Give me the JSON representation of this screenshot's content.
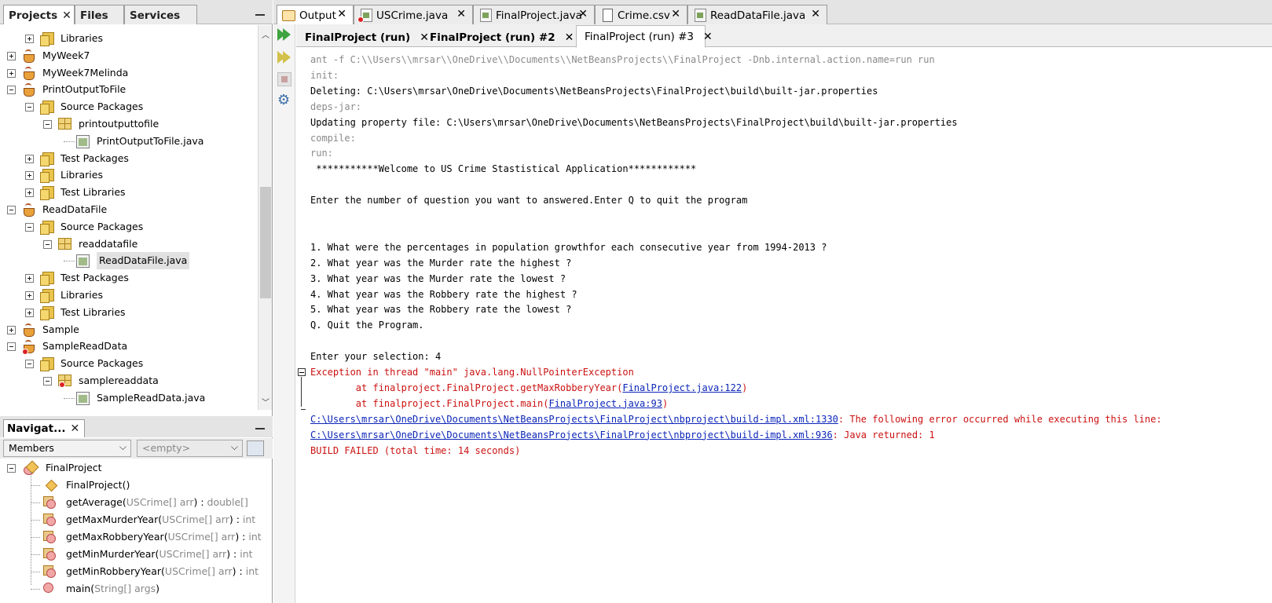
{
  "projects_panel": {
    "tabs": [
      "Projects",
      "Files",
      "Services"
    ],
    "tree": [
      {
        "label": "Libraries",
        "indent": 1,
        "toggle": "plus",
        "icon": "library-folder-icon"
      },
      {
        "label": "MyWeek7",
        "indent": 0,
        "toggle": "plus",
        "icon": "java-project-icon"
      },
      {
        "label": "MyWeek7Melinda",
        "indent": 0,
        "toggle": "plus",
        "icon": "java-project-icon"
      },
      {
        "label": "PrintOutputToFile",
        "indent": 0,
        "toggle": "minus",
        "icon": "java-project-icon"
      },
      {
        "label": "Source Packages",
        "indent": 1,
        "toggle": "minus",
        "icon": "source-folder-icon"
      },
      {
        "label": "printoutputtofile",
        "indent": 2,
        "toggle": "minus",
        "icon": "package-icon"
      },
      {
        "label": "PrintOutputToFile.java",
        "indent": 3,
        "toggle": "none",
        "icon": "java-file-icon"
      },
      {
        "label": "Test Packages",
        "indent": 1,
        "toggle": "plus",
        "icon": "test-folder-icon"
      },
      {
        "label": "Libraries",
        "indent": 1,
        "toggle": "plus",
        "icon": "library-folder-icon"
      },
      {
        "label": "Test Libraries",
        "indent": 1,
        "toggle": "plus",
        "icon": "library-folder-icon"
      },
      {
        "label": "ReadDataFile",
        "indent": 0,
        "toggle": "minus",
        "icon": "java-project-icon"
      },
      {
        "label": "Source Packages",
        "indent": 1,
        "toggle": "minus",
        "icon": "source-folder-icon"
      },
      {
        "label": "readdatafile",
        "indent": 2,
        "toggle": "minus",
        "icon": "package-icon"
      },
      {
        "label": "ReadDataFile.java",
        "indent": 3,
        "toggle": "none",
        "icon": "java-file-icon",
        "selected": true
      },
      {
        "label": "Test Packages",
        "indent": 1,
        "toggle": "plus",
        "icon": "test-folder-icon"
      },
      {
        "label": "Libraries",
        "indent": 1,
        "toggle": "plus",
        "icon": "library-folder-icon"
      },
      {
        "label": "Test Libraries",
        "indent": 1,
        "toggle": "plus",
        "icon": "library-folder-icon"
      },
      {
        "label": "Sample",
        "indent": 0,
        "toggle": "plus",
        "icon": "java-project-icon"
      },
      {
        "label": "SampleReadData",
        "indent": 0,
        "toggle": "minus",
        "icon": "java-project-error-icon"
      },
      {
        "label": "Source Packages",
        "indent": 1,
        "toggle": "minus",
        "icon": "source-folder-error-icon"
      },
      {
        "label": "samplereaddata",
        "indent": 2,
        "toggle": "minus",
        "icon": "package-error-icon"
      },
      {
        "label": "SampleReadData.java",
        "indent": 3,
        "toggle": "none",
        "icon": "java-file-icon"
      }
    ]
  },
  "navigator": {
    "title": "Navigat...",
    "filter": "Members",
    "context": "<empty>",
    "root": "FinalProject",
    "members": [
      {
        "name": "FinalProject()",
        "type": "",
        "icon": "constructor-icon"
      },
      {
        "name": "getAverage(",
        "params": "USCrime[] arr",
        "close": ") : ",
        "type": "double[]",
        "icon": "static-method-icon"
      },
      {
        "name": "getMaxMurderYear(",
        "params": "USCrime[] arr",
        "close": ") : ",
        "type": "int",
        "icon": "static-method-icon"
      },
      {
        "name": "getMaxRobberyYear(",
        "params": "USCrime[] arr",
        "close": ") : ",
        "type": "int",
        "icon": "static-method-icon"
      },
      {
        "name": "getMinMurderYear(",
        "params": "USCrime[] arr",
        "close": ") : ",
        "type": "int",
        "icon": "static-method-icon"
      },
      {
        "name": "getMinRobberyYear(",
        "params": "USCrime[] arr",
        "close": ") : ",
        "type": "int",
        "icon": "static-method-icon"
      },
      {
        "name": "main(",
        "params": "String[] args",
        "close": ")",
        "type": "",
        "icon": "main-method-icon"
      }
    ]
  },
  "editor_tabs": [
    {
      "label": "Output",
      "icon": "output-icon",
      "active": true
    },
    {
      "label": "USCrime.java",
      "icon": "java-file-error-icon"
    },
    {
      "label": "FinalProject.java",
      "icon": "java-file-icon"
    },
    {
      "label": "Crime.csv",
      "icon": "csv-file-icon"
    },
    {
      "label": "ReadDataFile.java",
      "icon": "java-file-icon"
    }
  ],
  "run_tabs": [
    {
      "label": "FinalProject (run)",
      "active": false
    },
    {
      "label": "FinalProject (run) #2",
      "active": false
    },
    {
      "label": "FinalProject (run) #3",
      "active": true
    }
  ],
  "console": {
    "lines": [
      {
        "text": "ant -f C:\\\\Users\\\\mrsar\\\\OneDrive\\\\Documents\\\\NetBeansProjects\\\\FinalProject -Dnb.internal.action.name=run run",
        "style": "gray"
      },
      {
        "text": "init:",
        "style": "gray"
      },
      {
        "text": "Deleting: C:\\Users\\mrsar\\OneDrive\\Documents\\NetBeansProjects\\FinalProject\\build\\built-jar.properties",
        "style": "normal"
      },
      {
        "text": "deps-jar:",
        "style": "gray"
      },
      {
        "text": "Updating property file: C:\\Users\\mrsar\\OneDrive\\Documents\\NetBeansProjects\\FinalProject\\build\\built-jar.properties",
        "style": "normal"
      },
      {
        "text": "compile:",
        "style": "gray"
      },
      {
        "text": "run:",
        "style": "gray"
      },
      {
        "text": " ***********Welcome to US Crime Stastistical Application************",
        "style": "normal"
      },
      {
        "text": "",
        "style": "normal"
      },
      {
        "text": "Enter the number of question you want to answered.Enter Q to quit the program",
        "style": "normal"
      },
      {
        "text": "",
        "style": "normal"
      },
      {
        "text": "",
        "style": "normal"
      },
      {
        "text": "1. What were the percentages in population growthfor each consecutive year from 1994-2013 ?",
        "style": "normal"
      },
      {
        "text": "2. What year was the Murder rate the highest ?",
        "style": "normal"
      },
      {
        "text": "3. What year was the Murder rate the lowest ?",
        "style": "normal"
      },
      {
        "text": "4. What year was the Robbery rate the highest ?",
        "style": "normal"
      },
      {
        "text": "5. What year was the Robbery rate the lowest ?",
        "style": "normal"
      },
      {
        "text": "Q. Quit the Program.",
        "style": "normal"
      },
      {
        "text": "",
        "style": "normal"
      },
      {
        "text": "Enter your selection: 4",
        "style": "normal"
      }
    ],
    "exception": "Exception in thread \"main\" java.lang.NullPointerException",
    "stack": [
      {
        "prefix": "        at finalproject.FinalProject.getMaxRobberyYear(",
        "link": "FinalProject.java:122",
        "suffix": ")"
      },
      {
        "prefix": "        at finalproject.FinalProject.main(",
        "link": "FinalProject.java:93",
        "suffix": ")"
      }
    ],
    "errors": [
      {
        "link": "C:\\Users\\mrsar\\OneDrive\\Documents\\NetBeansProjects\\FinalProject\\nbproject\\build-impl.xml:1330",
        "suffix": ": The following error occurred while executing this line:"
      },
      {
        "link": "C:\\Users\\mrsar\\OneDrive\\Documents\\NetBeansProjects\\FinalProject\\nbproject\\build-impl.xml:936",
        "suffix": ": Java returned: 1"
      }
    ],
    "result": "BUILD FAILED (total time: 14 seconds)"
  },
  "colors": {
    "error": "#cc1111",
    "link": "#0b25b8",
    "muted": "#8a8a8a"
  }
}
